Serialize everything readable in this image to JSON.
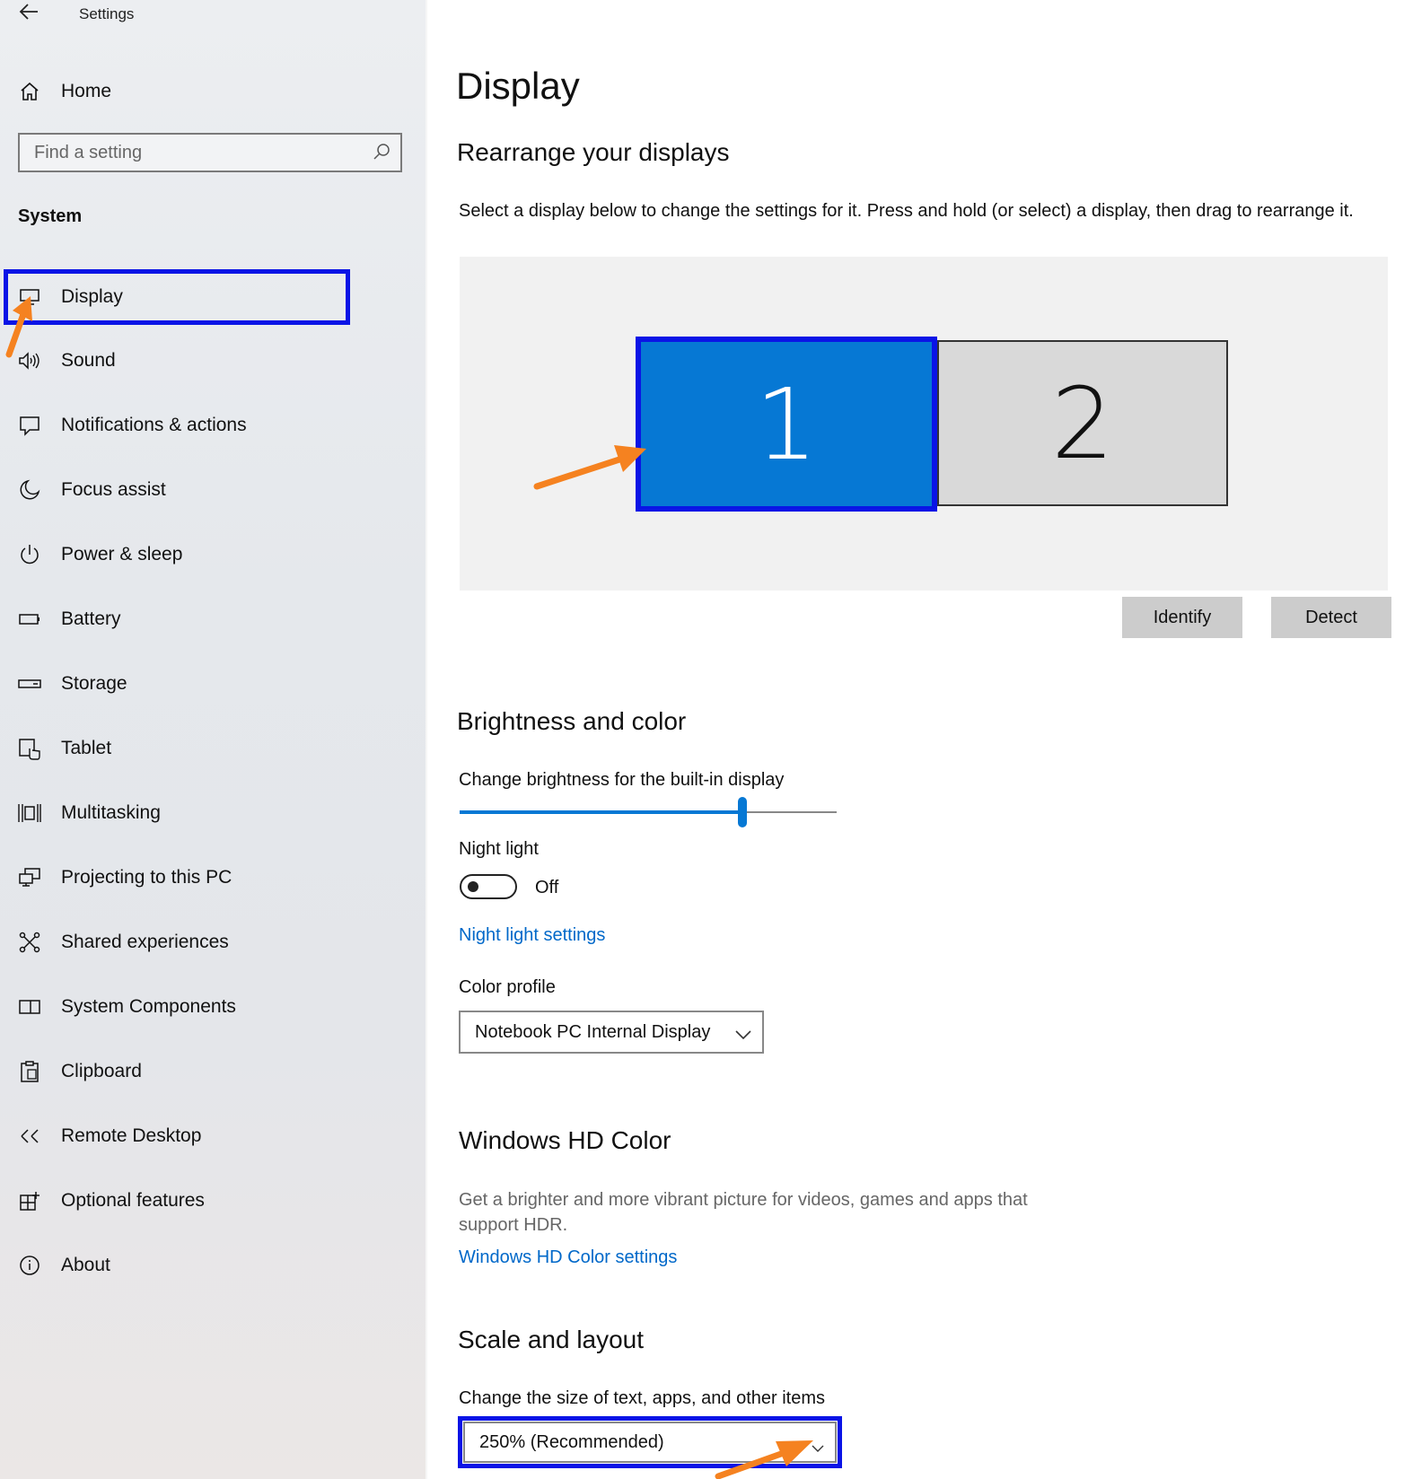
{
  "window": {
    "title": "Settings"
  },
  "sidebar": {
    "home_label": "Home",
    "search_placeholder": "Find a setting",
    "section_label": "System",
    "items": [
      {
        "label": "Display",
        "icon": "monitor-icon"
      },
      {
        "label": "Sound",
        "icon": "speaker-icon"
      },
      {
        "label": "Notifications & actions",
        "icon": "notification-icon"
      },
      {
        "label": "Focus assist",
        "icon": "moon-icon"
      },
      {
        "label": "Power & sleep",
        "icon": "power-icon"
      },
      {
        "label": "Battery",
        "icon": "battery-icon"
      },
      {
        "label": "Storage",
        "icon": "storage-icon"
      },
      {
        "label": "Tablet",
        "icon": "tablet-icon"
      },
      {
        "label": "Multitasking",
        "icon": "multitasking-icon"
      },
      {
        "label": "Projecting to this PC",
        "icon": "projecting-icon"
      },
      {
        "label": "Shared experiences",
        "icon": "shared-icon"
      },
      {
        "label": "System Components",
        "icon": "components-icon"
      },
      {
        "label": "Clipboard",
        "icon": "clipboard-icon"
      },
      {
        "label": "Remote Desktop",
        "icon": "remote-desktop-icon"
      },
      {
        "label": "Optional features",
        "icon": "optional-features-icon"
      },
      {
        "label": "About",
        "icon": "info-icon"
      }
    ],
    "selected": "Display"
  },
  "main": {
    "title": "Display",
    "rearrange": {
      "heading": "Rearrange your displays",
      "description": "Select a display below to change the settings for it. Press and hold (or select) a display, then drag to rearrange it.",
      "displays": [
        "1",
        "2"
      ],
      "selected_display": "1",
      "identify_label": "Identify",
      "detect_label": "Detect"
    },
    "brightness": {
      "heading": "Brightness and color",
      "slider_label": "Change brightness for the built-in display",
      "brightness_fraction": 0.75,
      "night_light_label": "Night light",
      "night_light_state": "Off",
      "night_light_settings_link": "Night light settings",
      "color_profile_label": "Color profile",
      "color_profile_value": "Notebook PC Internal Display"
    },
    "hd_color": {
      "heading": "Windows HD Color",
      "description": "Get a brighter and more vibrant picture for videos, games and apps that support HDR.",
      "link": "Windows HD Color settings"
    },
    "scale": {
      "heading": "Scale and layout",
      "label": "Change the size of text, apps, and other items",
      "value": "250% (Recommended)"
    }
  },
  "colors": {
    "accent": "#0678d4",
    "highlight_box": "#0a14e6",
    "annotation_arrow": "#f58220",
    "link": "#0068c9"
  }
}
